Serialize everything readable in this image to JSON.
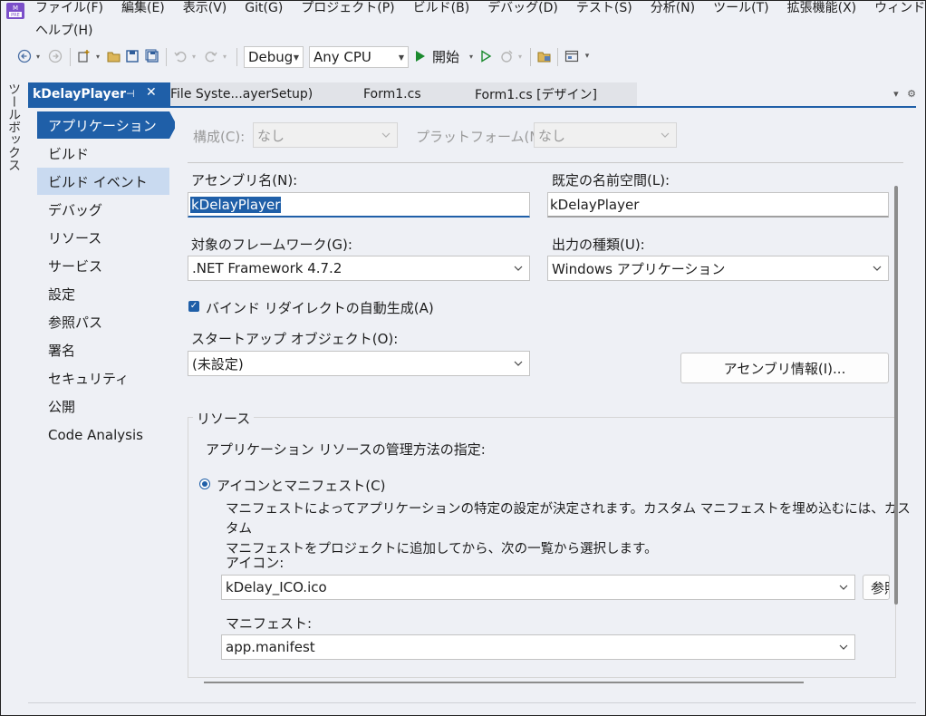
{
  "menu": {
    "items": [
      "ファイル(F)",
      "編集(E)",
      "表示(V)",
      "Git(G)",
      "プロジェクト(P)",
      "ビルド(B)",
      "デバッグ(D)",
      "テスト(S)",
      "分析(N)",
      "ツール(T)",
      "拡張機能(X)",
      "ウィンドウ(W)"
    ],
    "help": "ヘルプ(H)"
  },
  "toolbar": {
    "config": "Debug",
    "platform": "Any CPU",
    "start": "開始"
  },
  "toolbox_label": "ツールボックス",
  "tabs": {
    "active": "kDelayPlayer",
    "others": [
      "File Syste...ayerSetup)",
      "Form1.cs",
      "Form1.cs [デザイン]"
    ]
  },
  "nav": {
    "items": [
      "アプリケーション",
      "ビルド",
      "ビルド イベント",
      "デバッグ",
      "リソース",
      "サービス",
      "設定",
      "参照パス",
      "署名",
      "セキュリティ",
      "公開",
      "Code Analysis"
    ]
  },
  "form": {
    "config_label": "構成(C):",
    "config_value": "なし",
    "platform_label": "プラットフォーム(M):",
    "platform_value": "なし",
    "assembly_name_label": "アセンブリ名(N):",
    "assembly_name_value": "kDelayPlayer",
    "namespace_label": "既定の名前空間(L):",
    "namespace_value": "kDelayPlayer",
    "framework_label": "対象のフレームワーク(G):",
    "framework_value": ".NET Framework 4.7.2",
    "output_type_label": "出力の種類(U):",
    "output_type_value": "Windows アプリケーション",
    "binding_redirect_label": "バインド リダイレクトの自動生成(A)",
    "binding_redirect_checked": true,
    "startup_label": "スタートアップ オブジェクト(O):",
    "startup_value": "(未設定)",
    "assembly_info_button": "アセンブリ情報(I)..."
  },
  "resources": {
    "group_title": "リソース",
    "prompt": "アプリケーション リソースの管理方法の指定:",
    "option_label": "アイコンとマニフェスト(C)",
    "desc_line1": "マニフェストによってアプリケーションの特定の設定が決定されます。カスタム マニフェストを埋め込むには、カスタム",
    "desc_line2": "マニフェストをプロジェクトに追加してから、次の一覧から選択します。",
    "icon_label": "アイコン:",
    "icon_value": "kDelay_ICO.ico",
    "browse_button": "参照",
    "manifest_label": "マニフェスト:",
    "manifest_value": "app.manifest"
  },
  "colors": {
    "accent": "#1f5fa8",
    "hover": "#c9daf0",
    "panel": "#eef0f5"
  }
}
